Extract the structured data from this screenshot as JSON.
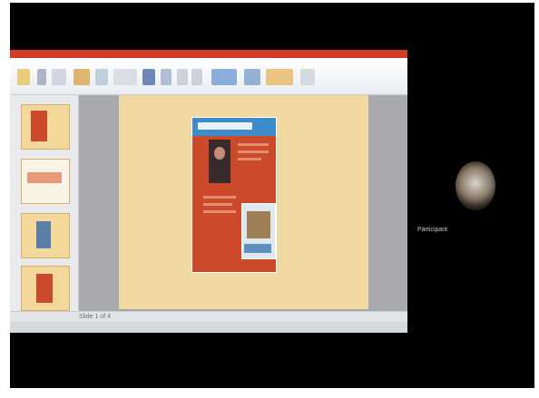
{
  "screen": {
    "shared_app": "presentation-editor",
    "status_text": "Slide 1 of 4"
  },
  "ribbon": {
    "icons": [
      "paste-icon",
      "cut-icon",
      "copy-icon",
      "new-slide-icon",
      "layout-icon",
      "font-icon",
      "bold-icon",
      "italic-icon",
      "align-left-icon",
      "align-center-icon",
      "shape-icon",
      "arrange-icon",
      "quick-styles-icon",
      "find-icon"
    ]
  },
  "slides_pane": {
    "thumbnails": [
      "slide-1",
      "slide-2",
      "slide-3",
      "slide-4"
    ]
  },
  "participant": {
    "name": "Participant"
  },
  "colors": {
    "ribbon_accent": "#d23a2a",
    "poster_red": "#cb4a2c",
    "poster_blue": "#3d8bc8",
    "slide_bg": "#f2d9a4",
    "thumb_bg": "#f4d79a"
  }
}
